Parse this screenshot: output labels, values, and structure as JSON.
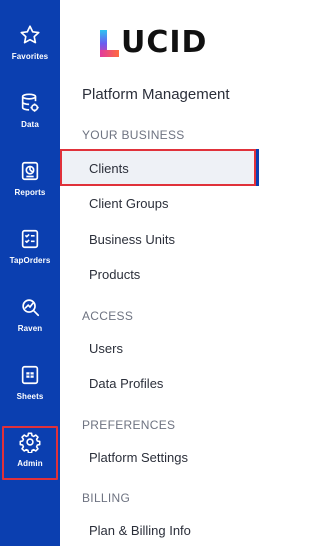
{
  "rail": {
    "items": [
      {
        "label": "Favorites",
        "icon": "star-icon"
      },
      {
        "label": "Data",
        "icon": "database-icon"
      },
      {
        "label": "Reports",
        "icon": "report-icon"
      },
      {
        "label": "TapOrders",
        "icon": "checklist-icon"
      },
      {
        "label": "Raven",
        "icon": "raven-icon"
      },
      {
        "label": "Sheets",
        "icon": "sheet-icon"
      },
      {
        "label": "Admin",
        "icon": "gear-icon"
      }
    ]
  },
  "logo": {
    "text": "UCID",
    "mark": "L"
  },
  "panel": {
    "title": "Platform Management",
    "sections": [
      {
        "heading": "YOUR BUSINESS",
        "items": [
          "Clients",
          "Client Groups",
          "Business Units",
          "Products"
        ]
      },
      {
        "heading": "ACCESS",
        "items": [
          "Users",
          "Data Profiles"
        ]
      },
      {
        "heading": "PREFERENCES",
        "items": [
          "Platform Settings"
        ]
      },
      {
        "heading": "BILLING",
        "items": [
          "Plan & Billing Info"
        ]
      }
    ],
    "active_item": "Clients"
  },
  "colors": {
    "rail": "#0b3fb0",
    "highlight": "#e0313a",
    "active_bg": "#eef1f6",
    "text": "#2b2f3a",
    "muted": "#6e7381"
  }
}
